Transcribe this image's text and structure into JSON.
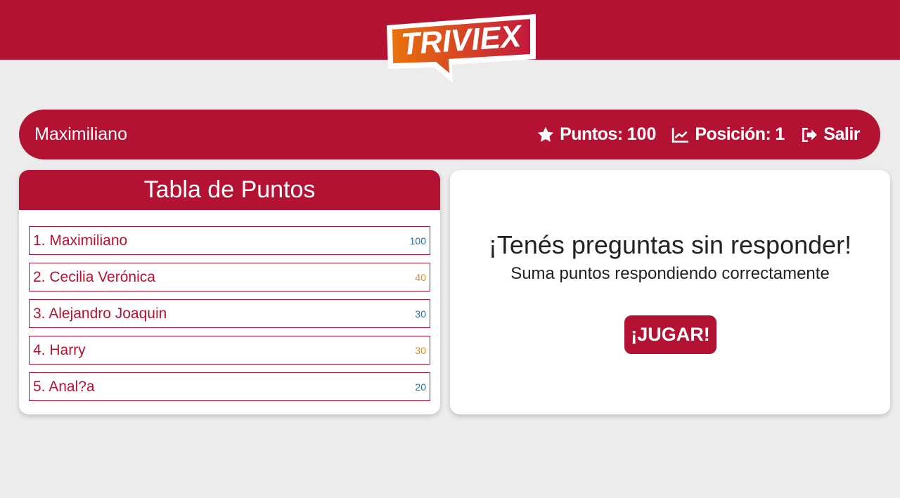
{
  "brand": {
    "logo_text": "TRIVIEX",
    "primary_color": "#b41232",
    "logo_gradient": [
      "#e9730c",
      "#c4193c"
    ]
  },
  "userbar": {
    "username": "Maximiliano",
    "points_label": "Puntos:",
    "points_value": "100",
    "position_label": "Posición:",
    "position_value": "1",
    "logout_label": "Salir",
    "icons": [
      "star-icon",
      "chart-line-icon",
      "sign-out-icon"
    ]
  },
  "leaderboard": {
    "title": "Tabla de Puntos",
    "entries": [
      {
        "name": "1. Maximiliano",
        "points": "100",
        "color": "#1f6fa8"
      },
      {
        "name": "2. Cecilia Verónica",
        "points": "40",
        "color": "#e08a1a"
      },
      {
        "name": "3. Alejandro Joaquin",
        "points": "30",
        "color": "#1f6fa8"
      },
      {
        "name": "4. Harry",
        "points": "30",
        "color": "#e08a1a"
      },
      {
        "name": "5. Anal?a",
        "points": "20",
        "color": "#1f6fa8"
      }
    ]
  },
  "prompt": {
    "title": "¡Tenés preguntas sin responder!",
    "subtitle": "Suma puntos respondiendo correctamente",
    "play_label": "¡JUGAR!"
  }
}
